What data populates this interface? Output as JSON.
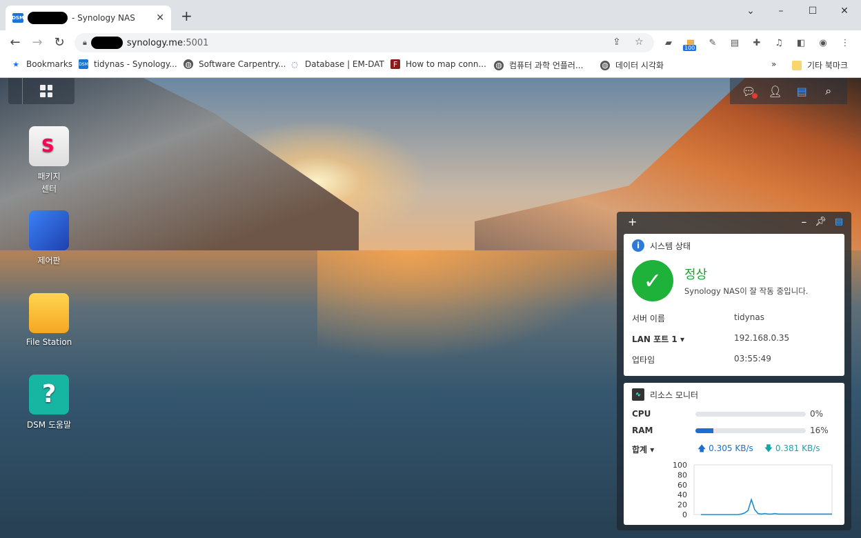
{
  "browser": {
    "tab_title": "- Synology NAS",
    "url_host": "synology.me",
    "url_port": ":5001",
    "bookmarks": [
      {
        "label": "Bookmarks"
      },
      {
        "label": "tidynas - Synology..."
      },
      {
        "label": "Software Carpentry..."
      },
      {
        "label": "Database | EM-DAT"
      },
      {
        "label": "How to map conn..."
      },
      {
        "label": "컴퓨터 과학 언플러..."
      },
      {
        "label": "데이터 시각화"
      }
    ],
    "other_bookmarks": "기타 북마크",
    "ext_badge": "100"
  },
  "desktop": {
    "icons": [
      {
        "label": "패키지 센터"
      },
      {
        "label": "제어판"
      },
      {
        "label": "File Station"
      },
      {
        "label": "DSM 도움말"
      }
    ]
  },
  "widget": {
    "system": {
      "title": "시스템 상태",
      "status": "정상",
      "message": "Synology NAS이 잘 작동 중입니다.",
      "rows": [
        {
          "key": "서버 이름",
          "value": "tidynas"
        },
        {
          "key": "LAN 포트 1 ▾",
          "value": "192.168.0.35"
        },
        {
          "key": "업타임",
          "value": "03:55:49"
        }
      ]
    },
    "resource": {
      "title": "리소스 모니터",
      "cpu_label": "CPU",
      "cpu_value": 0,
      "cpu_text": "0%",
      "ram_label": "RAM",
      "ram_value": 16,
      "ram_text": "16%",
      "total_label": "합계 ▾",
      "upload": "0.305 KB/s",
      "download": "0.381 KB/s"
    }
  },
  "chart_data": {
    "type": "line",
    "yticks": [
      "100",
      "80",
      "60",
      "40",
      "20",
      "0"
    ],
    "ylim": [
      0,
      100
    ],
    "values": [
      0,
      0,
      0,
      0,
      0,
      0,
      0,
      0,
      0,
      0,
      0,
      0,
      1,
      3,
      8,
      30,
      10,
      2,
      1,
      2,
      1,
      1,
      2,
      1,
      1,
      1,
      1,
      1,
      1,
      1,
      1,
      1,
      1,
      1,
      1,
      1,
      1,
      1,
      1,
      1
    ]
  }
}
